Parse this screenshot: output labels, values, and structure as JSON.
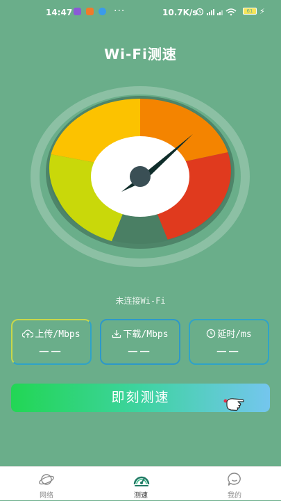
{
  "status_bar": {
    "time": "14:47",
    "dots": "···",
    "net_speed": "10.7K/s",
    "battery": "61"
  },
  "app": {
    "title": "Wi-Fi测速",
    "status_text": "未连接Wi-Fi",
    "accent_color": "#6aae8a"
  },
  "gauge": {
    "segment_colors": [
      "#c9d80a",
      "#fcc200",
      "#f48400",
      "#e03a1e"
    ]
  },
  "cards": {
    "upload": {
      "label": "上传/Mbps",
      "value": "——",
      "icon": "cloud-upload-icon"
    },
    "download": {
      "label": "下载/Mbps",
      "value": "——",
      "icon": "download-icon"
    },
    "latency": {
      "label": "延时/ms",
      "value": "——",
      "icon": "clock-icon"
    }
  },
  "test_button": {
    "label": "即刻测速"
  },
  "tabs": [
    {
      "label": "网络",
      "icon": "planet-icon"
    },
    {
      "label": "测速",
      "icon": "speedometer-icon"
    },
    {
      "label": "我的",
      "icon": "chat-face-icon"
    }
  ]
}
